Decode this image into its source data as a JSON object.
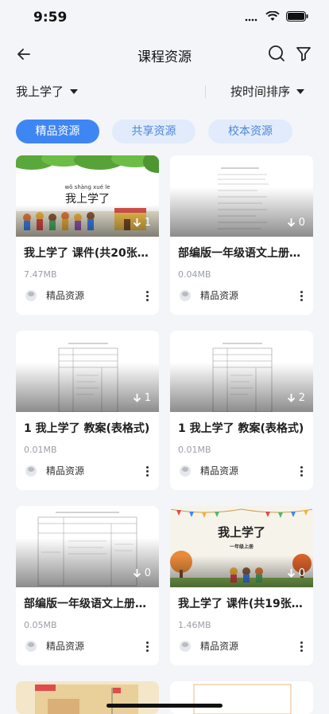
{
  "status": {
    "time": "9:59"
  },
  "nav": {
    "title": "课程资源"
  },
  "filters": {
    "left_label": "我上学了",
    "right_label": "按时间排序"
  },
  "tabs": [
    {
      "label": "精品资源",
      "active": true
    },
    {
      "label": "共享资源",
      "active": false
    },
    {
      "label": "校本资源",
      "active": false
    }
  ],
  "cards": [
    {
      "title": "我上学了 课件(共20张P…",
      "size": "7.47MB",
      "owner": "精品资源",
      "downloads": "1",
      "thumb_title": "我上学了",
      "thumb_pinyin": "wǒ shàng xué le"
    },
    {
      "title": "部编版一年级语文上册…",
      "size": "0.04MB",
      "owner": "精品资源",
      "downloads": "0"
    },
    {
      "title": "1 我上学了 教案(表格式)",
      "size": "0.01MB",
      "owner": "精品资源",
      "downloads": "1"
    },
    {
      "title": "1 我上学了 教案(表格式)",
      "size": "0.01MB",
      "owner": "精品资源",
      "downloads": "2"
    },
    {
      "title": "部编版一年级语文上册…",
      "size": "0.05MB",
      "owner": "精品资源",
      "downloads": "0"
    },
    {
      "title": "我上学了 课件(共19张P…",
      "size": "1.46MB",
      "owner": "精品资源",
      "downloads": "0",
      "thumb_title": "我上学了",
      "thumb_subtitle": "一年级上册"
    }
  ],
  "colors": {
    "accent": "#3f86f5",
    "tab_inactive_bg": "#e1ebfb",
    "page_bg": "#f3f5f9"
  }
}
